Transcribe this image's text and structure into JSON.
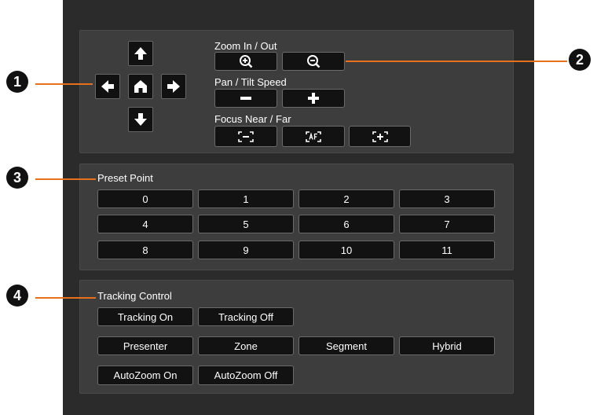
{
  "camera": {
    "zoom_label": "Zoom In / Out",
    "pan_tilt_label": "Pan / Tilt Speed",
    "focus_label": "Focus Near / Far",
    "arrows": {
      "up": "arrow-up-icon",
      "down": "arrow-down-icon",
      "left": "arrow-left-icon",
      "right": "arrow-right-icon",
      "home": "home-icon"
    },
    "zoom_buttons": [
      "zoom-in-icon",
      "zoom-out-icon"
    ],
    "speed_buttons": [
      "minus-icon",
      "plus-icon"
    ],
    "focus_buttons": [
      "focus-near-icon",
      "auto-focus-icon",
      "focus-far-icon"
    ]
  },
  "preset": {
    "label": "Preset Point",
    "points": [
      "0",
      "1",
      "2",
      "3",
      "4",
      "5",
      "6",
      "7",
      "8",
      "9",
      "10",
      "11"
    ]
  },
  "tracking": {
    "label": "Tracking Control",
    "tracking_on": "Tracking On",
    "tracking_off": "Tracking Off",
    "modes": [
      "Presenter",
      "Zone",
      "Segment",
      "Hybrid"
    ],
    "autozoom_on": "AutoZoom On",
    "autozoom_off": "AutoZoom Off"
  },
  "callouts": [
    "1",
    "2",
    "3",
    "4"
  ],
  "colors": {
    "panel": "#2b2b2b",
    "section": "#3d3d3d",
    "button": "#121212",
    "callout_line": "#e8701c"
  }
}
